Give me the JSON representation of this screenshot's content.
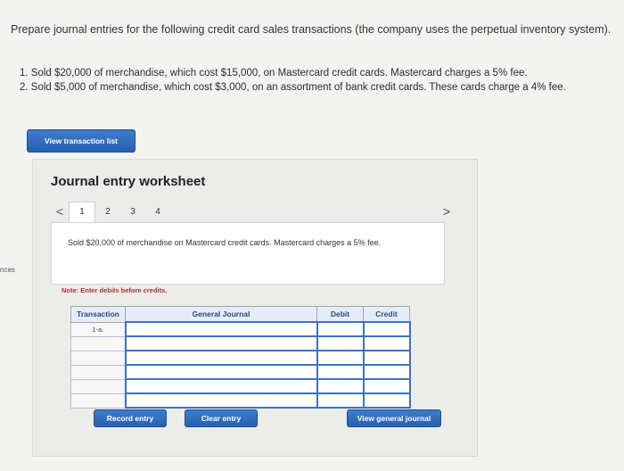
{
  "prompt": "Prepare journal entries for the following credit card sales transactions (the company uses the perpetual inventory system).",
  "items": [
    "1. Sold $20,000 of merchandise, which cost $15,000, on Mastercard credit cards. Mastercard charges a 5% fee.",
    "2. Sold $5,000 of merchandise, which cost $3,000, on an assortment of bank credit cards. These cards charge a 4% fee."
  ],
  "side_text": "nces",
  "view_transaction_list": "View transaction list",
  "worksheet": {
    "title": "Journal entry worksheet",
    "prev_arrow": "<",
    "next_arrow": ">",
    "pages": [
      "1",
      "2",
      "3",
      "4"
    ],
    "description": "Sold $20,000 of merchandise on Mastercard credit cards. Mastercard charges a 5% fee.",
    "note": "Note: Enter debits before credits.",
    "table": {
      "headers": [
        "Transaction",
        "General Journal",
        "Debit",
        "Credit"
      ],
      "rows": [
        "1-a.",
        "",
        "",
        "",
        "",
        ""
      ]
    },
    "buttons": {
      "record": "Record entry",
      "clear": "Clear entry",
      "view_general_journal": "View general journal"
    }
  },
  "colors": {
    "button_blue": "#2f6dbd",
    "note_red": "#aa3333",
    "header_bg": "#e6ecf5"
  }
}
